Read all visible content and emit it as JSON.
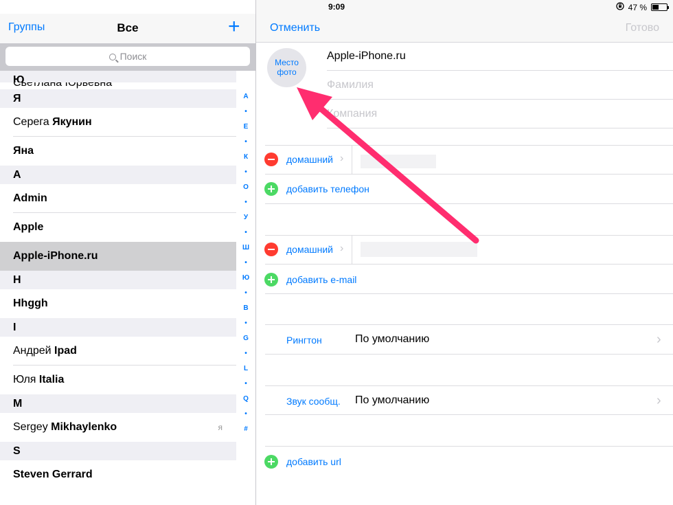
{
  "status": {
    "device": "iPad",
    "time": "9:09",
    "battery": "47 %",
    "battery_level": 0.47
  },
  "left_nav": {
    "groups": "Группы",
    "title": "Все",
    "add": "+"
  },
  "search": {
    "placeholder": "Поиск"
  },
  "contacts": {
    "partial_item": "Светлана Юрьевна",
    "sections": [
      {
        "header": "Ю"
      },
      {
        "header": "Я"
      },
      {
        "header": "A"
      },
      {
        "header": "H"
      },
      {
        "header": "I"
      },
      {
        "header": "M"
      },
      {
        "header": "S"
      }
    ],
    "items": [
      {
        "first": "Серега ",
        "last": "Якунин"
      },
      {
        "first": "",
        "last": "Яна"
      },
      {
        "first": "",
        "last": "Admin"
      },
      {
        "first": "",
        "last": "Apple"
      },
      {
        "first": "",
        "last": "Apple-iPhone.ru"
      },
      {
        "first": "",
        "last": "Hhggh"
      },
      {
        "first": "Андрей ",
        "last": "Ipad"
      },
      {
        "first": "Юля ",
        "last": "Italia"
      },
      {
        "first": "Sergey ",
        "last": "Mikhaylenko",
        "badge": "я"
      },
      {
        "first": "",
        "last": "Steven Gerrard"
      }
    ]
  },
  "index_letters": [
    "А",
    "•",
    "Е",
    "•",
    "К",
    "•",
    "О",
    "•",
    "У",
    "•",
    "Ш",
    "•",
    "Ю",
    "•",
    "B",
    "•",
    "G",
    "•",
    "L",
    "•",
    "Q",
    "•",
    "#"
  ],
  "right_nav": {
    "cancel": "Отменить",
    "done": "Готово"
  },
  "photo": {
    "line1": "Место",
    "line2": "фото"
  },
  "name_fields": {
    "first": "Apple-iPhone.ru",
    "last_placeholder": "Фамилия",
    "company_placeholder": "Компания"
  },
  "phone": {
    "label": "домашний",
    "add": "добавить телефон"
  },
  "email": {
    "label": "домашний",
    "add": "добавить e-mail"
  },
  "ringtone": {
    "label": "Рингтон",
    "value": "По умолчанию"
  },
  "text_tone": {
    "label": "Звук сообщ.",
    "value": "По умолчанию"
  },
  "url": {
    "add": "добавить url"
  },
  "colors": {
    "accent": "#007aff",
    "arrow": "#ff2d6f",
    "remove": "#ff3b30",
    "add": "#4cd964"
  }
}
